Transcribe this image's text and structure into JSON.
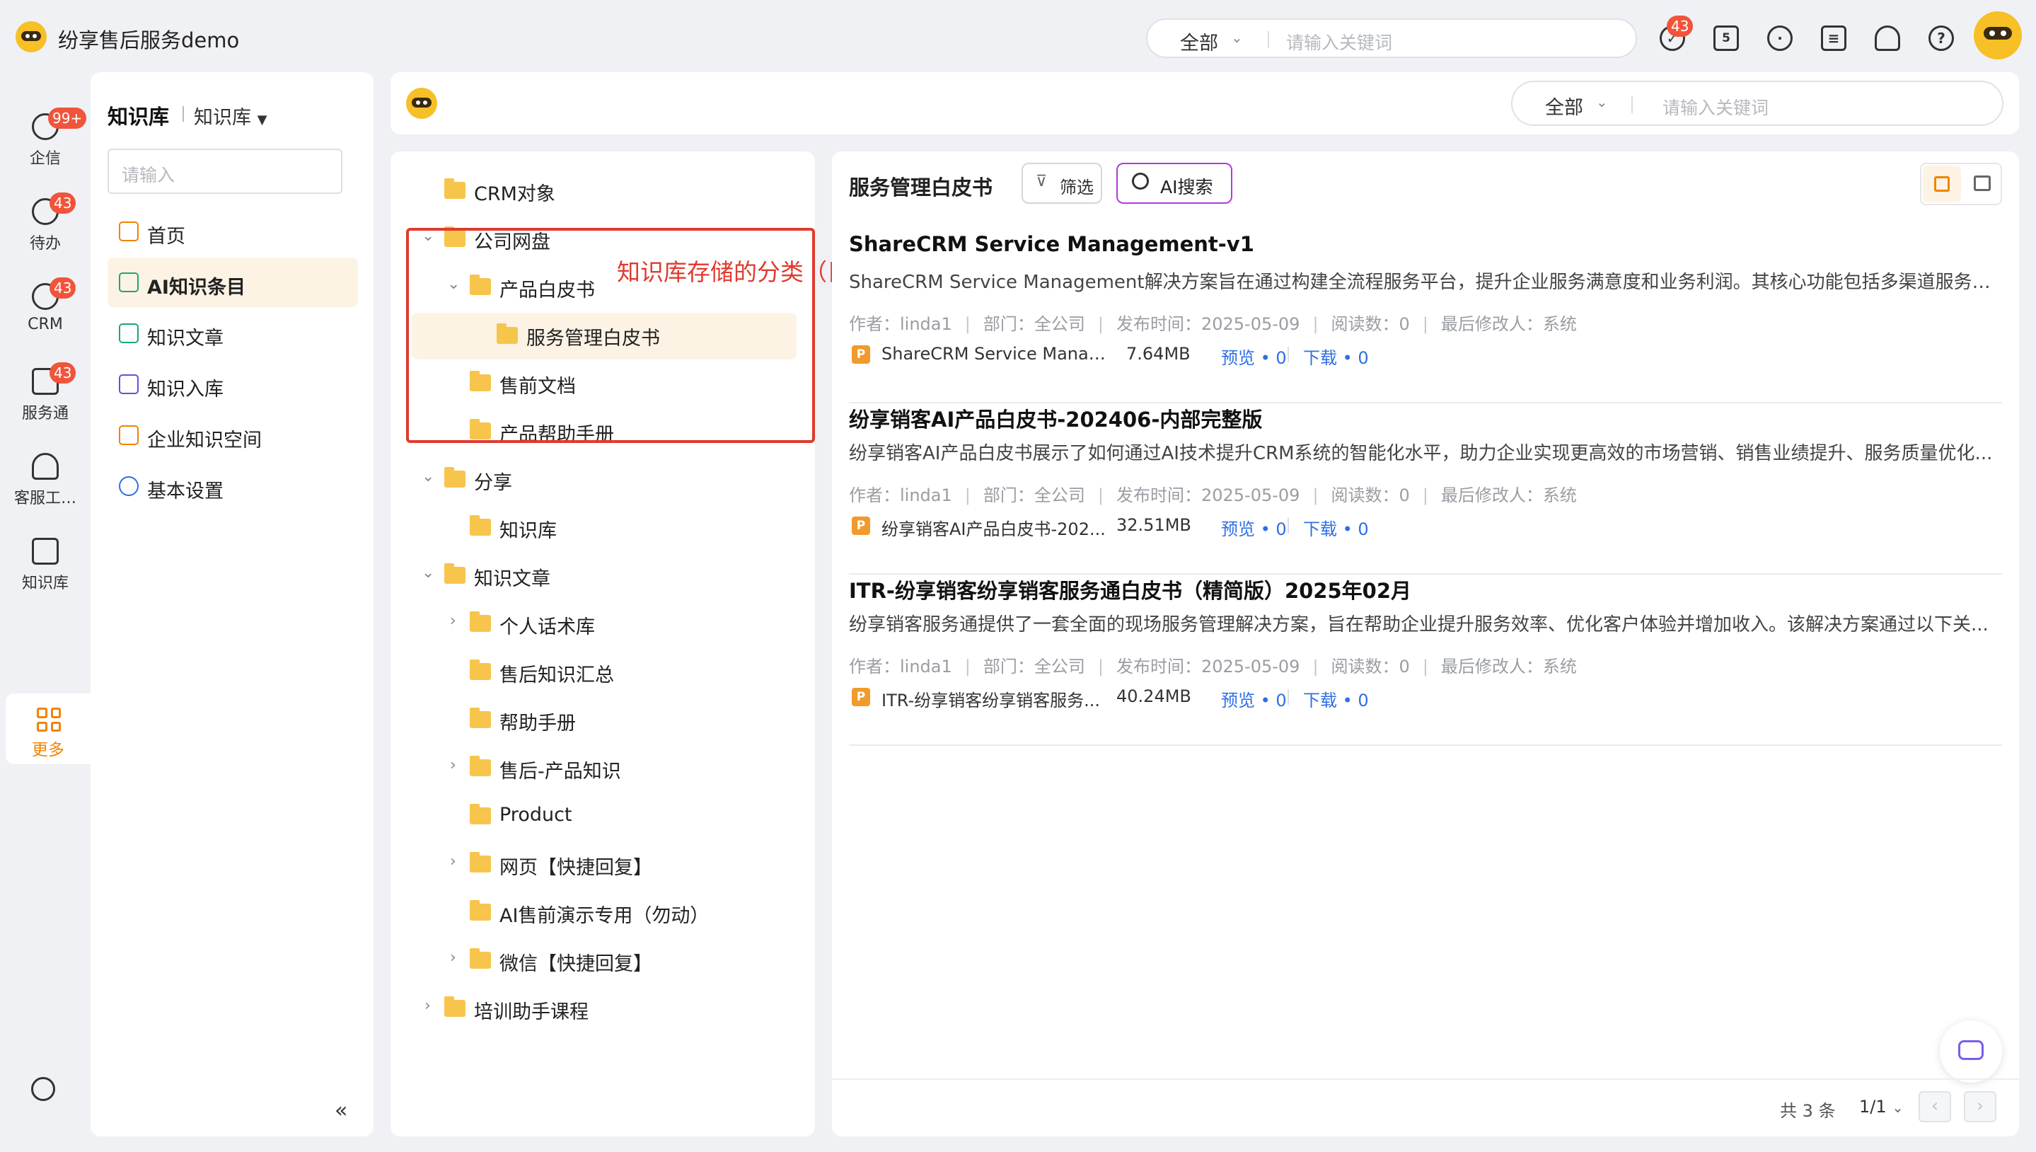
{
  "app": {
    "title": "纷享售后服务demo"
  },
  "top_search": {
    "scope": "全部",
    "placeholder": "请输入关键词"
  },
  "top_icons": {
    "notifications_badge": "43",
    "icons": [
      "bell-check-icon",
      "calendar-icon",
      "clock-icon",
      "inbox-icon",
      "user-settings-icon",
      "help-icon"
    ]
  },
  "rail": {
    "items": [
      {
        "label": "企信",
        "badge": "99+"
      },
      {
        "label": "待办",
        "badge": "43"
      },
      {
        "label": "CRM",
        "badge": "43"
      },
      {
        "label": "服务通",
        "badge": "43"
      },
      {
        "label": "客服工…",
        "badge": ""
      },
      {
        "label": "知识库",
        "badge": ""
      }
    ],
    "more_label": "更多"
  },
  "nav": {
    "title": "知识库",
    "subtitle": "知识库",
    "search_placeholder": "请输入",
    "items": [
      {
        "label": "首页",
        "icon": "home-icon"
      },
      {
        "label": "AI知识条目",
        "icon": "book-icon"
      },
      {
        "label": "知识文章",
        "icon": "document-icon"
      },
      {
        "label": "知识入库",
        "icon": "import-icon"
      },
      {
        "label": "企业知识空间",
        "icon": "layers-icon"
      },
      {
        "label": "基本设置",
        "icon": "settings-icon"
      }
    ],
    "active_index": 1
  },
  "header_search": {
    "scope": "全部",
    "placeholder": "请输入关键词"
  },
  "tree": {
    "nodes": [
      {
        "label": "CRM对象",
        "level": 0,
        "arrow": ""
      },
      {
        "label": "公司网盘",
        "level": 0,
        "arrow": "down"
      },
      {
        "label": "产品白皮书",
        "level": 1,
        "arrow": "down"
      },
      {
        "label": "服务管理白皮书",
        "level": 2,
        "arrow": "",
        "selected": true
      },
      {
        "label": "售前文档",
        "level": 1,
        "arrow": ""
      },
      {
        "label": "产品帮助手册",
        "level": 1,
        "arrow": ""
      },
      {
        "label": "分享",
        "level": 0,
        "arrow": "down"
      },
      {
        "label": "知识库",
        "level": 1,
        "arrow": ""
      },
      {
        "label": "知识文章",
        "level": 0,
        "arrow": "down"
      },
      {
        "label": "个人话术库",
        "level": 1,
        "arrow": "right"
      },
      {
        "label": "售后知识汇总",
        "level": 1,
        "arrow": ""
      },
      {
        "label": "帮助手册",
        "level": 1,
        "arrow": ""
      },
      {
        "label": "售后-产品知识",
        "level": 1,
        "arrow": "right"
      },
      {
        "label": "Product",
        "level": 1,
        "arrow": ""
      },
      {
        "label": "网页【快捷回复】",
        "level": 1,
        "arrow": "right"
      },
      {
        "label": "AI售前演示专用（勿动）",
        "level": 1,
        "arrow": ""
      },
      {
        "label": "微信【快捷回复】",
        "level": 1,
        "arrow": "right"
      },
      {
        "label": "培训助手课程",
        "level": 0,
        "arrow": "right"
      }
    ]
  },
  "annotation": {
    "text": "知识库存储的分类（目录）结构",
    "color": "#e03a2e"
  },
  "content": {
    "title": "服务管理白皮书",
    "filter_label": "筛选",
    "ai_search_label": "AI搜索",
    "articles": [
      {
        "title": "ShareCRM Service Management-v1",
        "desc": "ShareCRM Service Management解决方案旨在通过构建全流程服务平台，提升企业服务满意度和业务利润。其核心功能包括多渠道服务受理...",
        "author": "作者：linda1",
        "dept": "部门：全公司",
        "published": "发布时间：2025-05-09",
        "reads": "阅读数：0",
        "modifier": "最后修改人：系统",
        "file_name": "ShareCRM Service Manag...",
        "file_size": "7.64MB",
        "preview": "预览 • 0",
        "download": "下载 • 0"
      },
      {
        "title": "纷享销客AI产品白皮书-202406-内部完整版",
        "desc": "纷享销客AI产品白皮书展示了如何通过AI技术提升CRM系统的智能化水平，助力企业实现更高效的市场营销、销售业绩提升、服务质量优化...",
        "author": "作者：linda1",
        "dept": "部门：全公司",
        "published": "发布时间：2025-05-09",
        "reads": "阅读数：0",
        "modifier": "最后修改人：系统",
        "file_name": "纷享销客AI产品白皮书-202...",
        "file_size": "32.51MB",
        "preview": "预览 • 0",
        "download": "下载 • 0"
      },
      {
        "title": "ITR-纷享销客纷享销客服务通白皮书（精简版）2025年02月",
        "desc": "纷享销客服务通提供了一套全面的现场服务管理解决方案，旨在帮助企业提升服务效率、优化客户体验并增加收入。该解决方案通过以下关...",
        "author": "作者：linda1",
        "dept": "部门：全公司",
        "published": "发布时间：2025-05-09",
        "reads": "阅读数：0",
        "modifier": "最后修改人：系统",
        "file_name": "ITR-纷享销客纷享销客服务...",
        "file_size": "40.24MB",
        "preview": "预览 • 0",
        "download": "下载 • 0"
      }
    ],
    "pagination": {
      "total": "共 3 条",
      "page": "1/1"
    }
  }
}
